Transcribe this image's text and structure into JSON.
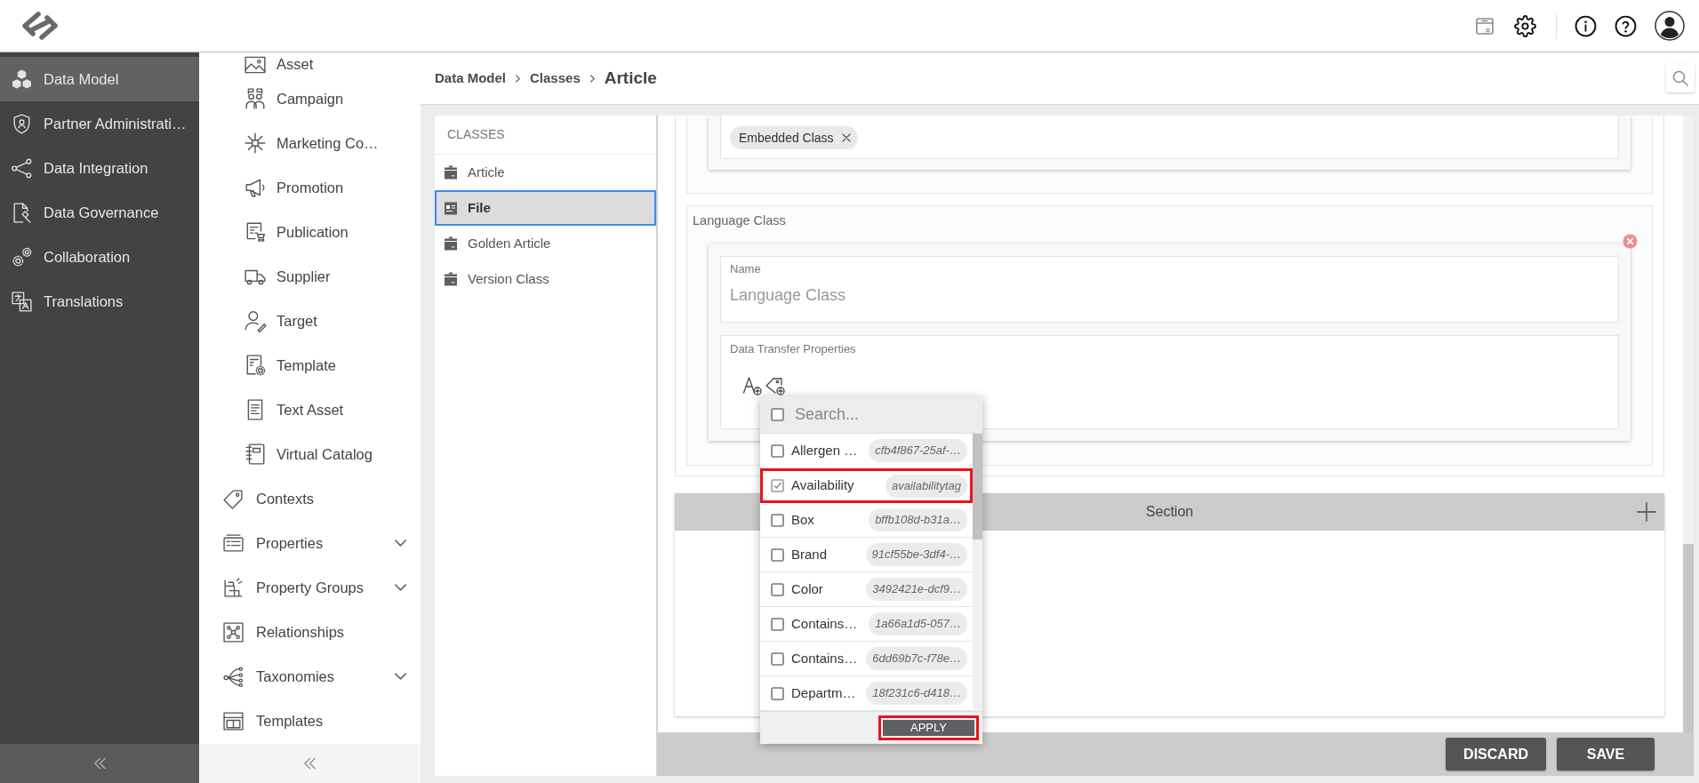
{
  "main_nav": {
    "items": [
      {
        "label": "Data Model",
        "selected": true
      },
      {
        "label": "Partner Administrati…",
        "selected": false
      },
      {
        "label": "Data Integration",
        "selected": false
      },
      {
        "label": "Data Governance",
        "selected": false
      },
      {
        "label": "Collaboration",
        "selected": false
      },
      {
        "label": "Translations",
        "selected": false
      }
    ]
  },
  "sub_nav": {
    "items": [
      {
        "children": [
          {
            "label": "Asset"
          },
          {
            "label": "Campaign"
          },
          {
            "label": "Marketing Co…"
          },
          {
            "label": "Promotion"
          },
          {
            "label": "Publication"
          },
          {
            "label": "Supplier"
          },
          {
            "label": "Target"
          },
          {
            "label": "Template"
          },
          {
            "label": "Text Asset"
          },
          {
            "label": "Virtual Catalog"
          }
        ]
      },
      {
        "label": "Contexts",
        "expandable": false
      },
      {
        "label": "Properties",
        "expandable": true,
        "expanded": false
      },
      {
        "label": "Property Groups",
        "expandable": true,
        "expanded": false
      },
      {
        "label": "Relationships",
        "expandable": false
      },
      {
        "label": "Taxonomies",
        "expandable": true,
        "expanded": false
      },
      {
        "label": "Templates",
        "expandable": false
      }
    ]
  },
  "breadcrumb": {
    "items": [
      {
        "label": "Data Model"
      },
      {
        "label": "Classes"
      },
      {
        "label": "Article"
      }
    ]
  },
  "classes_panel": {
    "title": "CLASSES",
    "items": [
      {
        "label": "Article",
        "selected": false
      },
      {
        "label": "File",
        "selected": true
      },
      {
        "label": "Golden Article",
        "selected": false
      },
      {
        "label": "Version Class",
        "selected": false
      }
    ]
  },
  "editor": {
    "upper_group": {
      "chips": [
        {
          "label": "Embedded Class"
        }
      ]
    },
    "language_class": {
      "title": "Language Class",
      "name_field": {
        "label": "Name",
        "value": "Language Class"
      },
      "data_transfer_properties": {
        "label": "Data Transfer Properties"
      }
    },
    "section": {
      "title": "Section"
    }
  },
  "dropdown": {
    "select_all": {
      "checked": false
    },
    "search": {
      "placeholder": "Search..."
    },
    "options": [
      {
        "label": "Allergen …",
        "tag": "cfb4f867-25af-…",
        "checked": false,
        "highlighted": false
      },
      {
        "label": "Availability",
        "tag": "availabilitytag",
        "checked": true,
        "highlighted": true
      },
      {
        "label": "Box",
        "tag": "bffb108d-b31a…",
        "checked": false,
        "highlighted": false
      },
      {
        "label": "Brand",
        "tag": "91cf55be-3df4-…",
        "checked": false,
        "highlighted": false
      },
      {
        "label": "Color",
        "tag": "3492421e-dcf9…",
        "checked": false,
        "highlighted": false
      },
      {
        "label": "Contains…",
        "tag": "1a66a1d5-057…",
        "checked": false,
        "highlighted": false
      },
      {
        "label": "Contains…",
        "tag": "6dd69b7c-f78e…",
        "checked": false,
        "highlighted": false
      },
      {
        "label": "Departm…",
        "tag": "18f231c6-d418…",
        "checked": false,
        "highlighted": false
      }
    ],
    "apply_button": {
      "label": "APPLY",
      "highlighted": true
    }
  },
  "footer": {
    "buttons": [
      {
        "label": "DISCARD"
      },
      {
        "label": "SAVE"
      }
    ]
  }
}
